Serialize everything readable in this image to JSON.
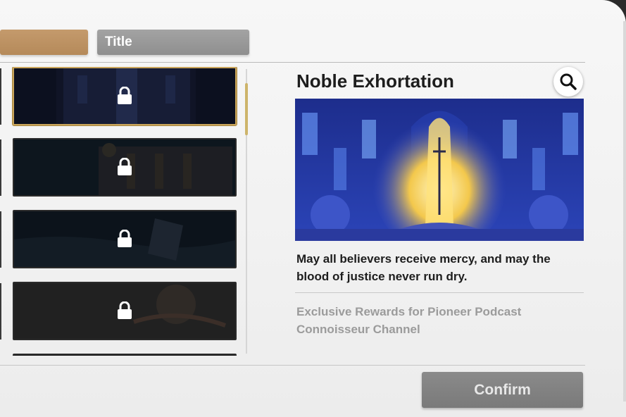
{
  "tabs": [
    {
      "label": ""
    },
    {
      "label": "Title"
    }
  ],
  "detail": {
    "title": "Noble Exhortation",
    "quote": "May all believers receive mercy, and may the blood of justice never run dry.",
    "source": "Exclusive Rewards for Pioneer Podcast Connoisseur Channel"
  },
  "list": {
    "items": [
      {
        "state": "locked",
        "selected": true
      },
      {
        "state": "locked",
        "selected": false
      },
      {
        "state": "locked",
        "selected": false
      },
      {
        "state": "locked",
        "selected": false
      }
    ]
  },
  "icons": {
    "zoom": "magnifier-icon",
    "lock": "lock-icon"
  },
  "colors": {
    "accent_gold": "#c9a45a",
    "tab_active": "#b58a5a",
    "tab_inactive": "#999999",
    "confirm_bg": "#808080"
  },
  "actions": {
    "confirm_label": "Confirm"
  }
}
